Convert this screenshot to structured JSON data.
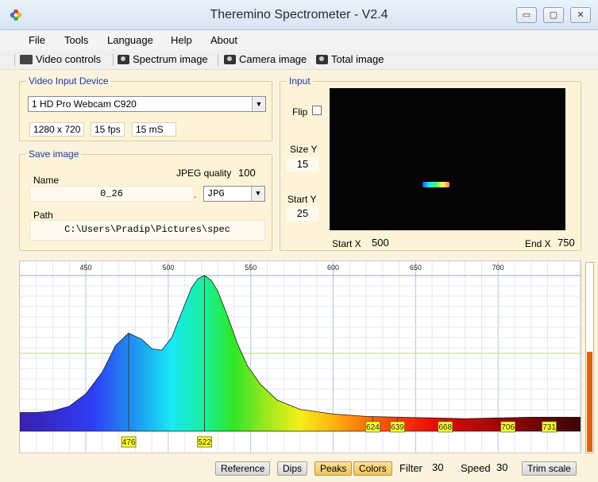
{
  "window": {
    "title": "Theremino Spectrometer - V2.4",
    "minimize": "▭",
    "maximize": "▢",
    "close": "✕"
  },
  "menu": [
    "File",
    "Tools",
    "Language",
    "Help",
    "About"
  ],
  "toolbar": {
    "video_controls": "Video controls",
    "spectrum_image": "Spectrum image",
    "camera_image": "Camera image",
    "total_image": "Total image"
  },
  "video_input": {
    "legend": "Video Input Device",
    "device": "1 HD Pro Webcam C920",
    "resolution": "1280 x 720",
    "fps": "15 fps",
    "ms": "15 mS"
  },
  "save_image": {
    "legend": "Save image",
    "name_label": "Name",
    "name_value": "0_26",
    "jpeg_quality_label": "JPEG quality",
    "jpeg_quality_value": "100",
    "dot": ".",
    "format": "JPG",
    "path_label": "Path",
    "path_value": "C:\\Users\\Pradip\\Pictures\\spec"
  },
  "input": {
    "legend": "Input",
    "flip_label": "Flip",
    "size_y_label": "Size Y",
    "size_y_value": "15",
    "start_y_label": "Start Y",
    "start_y_value": "25",
    "start_x_label": "Start X",
    "start_x_value": "500",
    "end_x_label": "End X",
    "end_x_value": "750"
  },
  "chart_data": {
    "type": "area",
    "x_ticks": [
      450,
      500,
      550,
      600,
      650,
      700
    ],
    "xlim": [
      410,
      750
    ],
    "x": [
      410,
      420,
      430,
      440,
      450,
      460,
      468,
      476,
      484,
      490,
      496,
      502,
      508,
      514,
      518,
      522,
      526,
      530,
      536,
      542,
      548,
      556,
      566,
      580,
      600,
      620,
      640,
      660,
      680,
      700,
      720,
      740,
      750
    ],
    "y": [
      0.12,
      0.12,
      0.13,
      0.16,
      0.24,
      0.38,
      0.55,
      0.63,
      0.59,
      0.53,
      0.52,
      0.6,
      0.76,
      0.92,
      0.98,
      1.0,
      0.97,
      0.9,
      0.74,
      0.56,
      0.42,
      0.3,
      0.2,
      0.14,
      0.11,
      0.095,
      0.09,
      0.085,
      0.08,
      0.085,
      0.09,
      0.09,
      0.09
    ],
    "ylim": [
      0,
      1
    ],
    "peaks": [
      "476",
      "522",
      "624",
      "639",
      "668",
      "706",
      "731"
    ],
    "grid": true
  },
  "bottom": {
    "reference": "Reference",
    "dips": "Dips",
    "peaks": "Peaks",
    "colors": "Colors",
    "filter_label": "Filter",
    "filter_value": "30",
    "speed_label": "Speed",
    "speed_value": "30",
    "trim_scale": "Trim scale"
  },
  "level_bar": {
    "fraction": 0.53
  }
}
